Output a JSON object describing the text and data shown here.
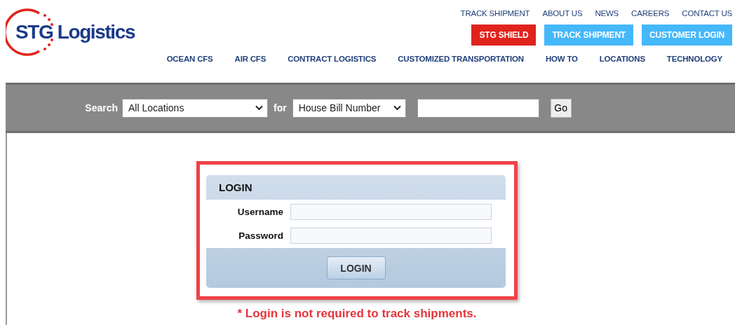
{
  "logo": {
    "text": "STG Logistics"
  },
  "top_links": [
    "TRACK SHIPMENT",
    "ABOUT US",
    "NEWS",
    "CAREERS",
    "CONTACT US"
  ],
  "action_buttons": [
    {
      "label": "STG SHIELD",
      "color": "#e0231c"
    },
    {
      "label": "TRACK SHIPMENT",
      "color": "#45b8fb"
    },
    {
      "label": "CUSTOMER LOGIN",
      "color": "#45b8fb"
    }
  ],
  "main_nav": [
    "OCEAN CFS",
    "AIR CFS",
    "CONTRACT LOGISTICS",
    "CUSTOMIZED TRANSPORTATION",
    "HOW TO",
    "LOCATIONS",
    "TECHNOLOGY"
  ],
  "search_bar": {
    "label": "Search",
    "location_select": "All Locations",
    "for_label": "for",
    "type_select": "House Bill Number",
    "go_button": "Go"
  },
  "login": {
    "title": "LOGIN",
    "fields": [
      {
        "label": "Username"
      },
      {
        "label": "Password"
      }
    ],
    "button": "LOGIN"
  },
  "note": "* Login is not required to track shipments."
}
